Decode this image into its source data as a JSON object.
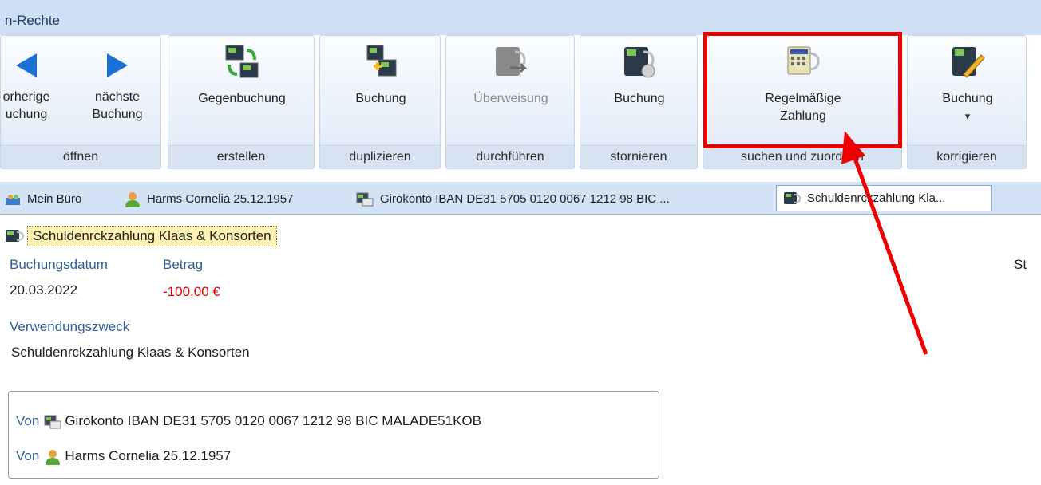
{
  "ribbon": {
    "title": "n-Rechte",
    "groups": [
      {
        "label": "öffnen",
        "buttons": [
          {
            "line1": "orherige",
            "line2": "uchung"
          },
          {
            "line1": "nächste",
            "line2": "Buchung"
          }
        ]
      },
      {
        "label": "erstellen",
        "buttons": [
          {
            "line1": "Gegenbuchung"
          }
        ]
      },
      {
        "label": "duplizieren",
        "buttons": [
          {
            "line1": "Buchung"
          }
        ]
      },
      {
        "label": "durchführen",
        "buttons": [
          {
            "line1": "Überweisung",
            "disabled": true
          }
        ]
      },
      {
        "label": "stornieren",
        "buttons": [
          {
            "line1": "Buchung"
          }
        ]
      },
      {
        "label": "suchen und zuordnen",
        "buttons": [
          {
            "line1": "Regelmäßige",
            "line2": "Zahlung"
          }
        ]
      },
      {
        "label": "korrigieren",
        "buttons": [
          {
            "line1": "Buchung",
            "dropdown": "▾"
          }
        ]
      }
    ]
  },
  "tabs": [
    {
      "label": "Mein Büro",
      "icon": "office-icon"
    },
    {
      "label": "Harms Cornelia 25.12.1957",
      "icon": "person-icon"
    },
    {
      "label": "Girokonto IBAN DE31 5705 0120 0067 1212 98 BIC ...",
      "icon": "bank-account-icon"
    },
    {
      "label": "Schuldenrckzahlung Kla...",
      "icon": "booking-icon",
      "active": true
    }
  ],
  "document": {
    "title": "Schuldenrckzahlung Klaas & Konsorten",
    "buchungsdatum_label": "Buchungsdatum",
    "buchungsdatum": "20.03.2022",
    "betrag_label": "Betrag",
    "betrag": "-100,00 €",
    "status_label_partial": "St",
    "verwendungszweck_label": "Verwendungszweck",
    "verwendungszweck": "Schuldenrckzahlung Klaas & Konsorten",
    "links": [
      {
        "prefix": "Von",
        "text": "Girokonto IBAN DE31 5705 0120 0067 1212 98 BIC MALADE51KOB",
        "icon": "bank-account-icon"
      },
      {
        "prefix": "Von",
        "text": "Harms Cornelia 25.12.1957",
        "icon": "person-icon"
      }
    ]
  },
  "annotation": {
    "highlight_color": "#ee0000"
  },
  "colors": {
    "ribbon_bg": "#cfe0f5",
    "label_blue": "#2f5f96",
    "amount_red": "#e00000",
    "title_highlight": "#fff2b3"
  }
}
